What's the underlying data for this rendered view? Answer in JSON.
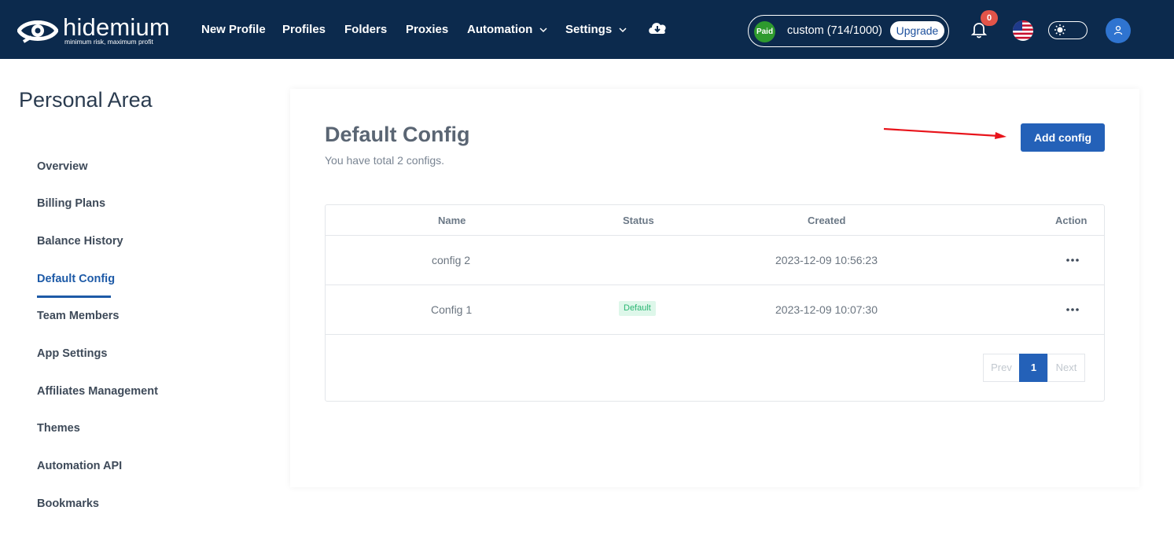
{
  "brand": {
    "name": "hidemium",
    "tagline": "minimum risk, maximum profit"
  },
  "nav": {
    "items": [
      {
        "label": "New Profile",
        "dropdown": false
      },
      {
        "label": "Profiles",
        "dropdown": false
      },
      {
        "label": "Folders",
        "dropdown": false
      },
      {
        "label": "Proxies",
        "dropdown": false
      },
      {
        "label": "Automation",
        "dropdown": true
      },
      {
        "label": "Settings",
        "dropdown": true
      }
    ],
    "download_icon": "cloud-download-icon"
  },
  "plan": {
    "badge": "Paid",
    "text": "custom (714/1000)",
    "upgrade_label": "Upgrade"
  },
  "notifications": {
    "count": "0"
  },
  "colors": {
    "topbar": "#0c2a4d",
    "accent": "#2461b8",
    "active_link": "#1d5aa7",
    "badge_red": "#e25449",
    "paid_green": "#2e9a2e",
    "default_badge_bg": "#def7ea",
    "default_badge_text": "#2bb673",
    "annotation_arrow": "#e8141b"
  },
  "sidebar": {
    "title": "Personal Area",
    "items": [
      {
        "label": "Overview",
        "active": false
      },
      {
        "label": "Billing Plans",
        "active": false
      },
      {
        "label": "Balance History",
        "active": false
      },
      {
        "label": "Default Config",
        "active": true
      },
      {
        "label": "Team Members",
        "active": false
      },
      {
        "label": "App Settings",
        "active": false
      },
      {
        "label": "Affiliates Management",
        "active": false
      },
      {
        "label": "Themes",
        "active": false
      },
      {
        "label": "Automation API",
        "active": false
      },
      {
        "label": "Bookmarks",
        "active": false
      }
    ]
  },
  "main": {
    "title": "Default Config",
    "subtitle": "You have total 2 configs.",
    "add_button": "Add config",
    "table": {
      "columns": [
        "Name",
        "Status",
        "Created",
        "Action"
      ],
      "rows": [
        {
          "name": "config 2",
          "status": "",
          "created": "2023-12-09 10:56:23"
        },
        {
          "name": "Config 1",
          "status": "Default",
          "created": "2023-12-09 10:07:30"
        }
      ]
    },
    "pagination": {
      "prev": "Prev",
      "current": "1",
      "next": "Next"
    }
  }
}
